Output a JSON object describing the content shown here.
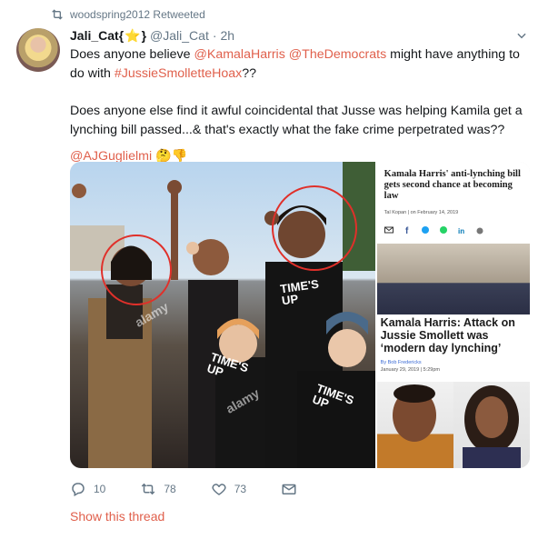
{
  "retweet": {
    "text": "woodspring2012 Retweeted",
    "icon": "retweet-icon"
  },
  "author": {
    "name": "Jali_Cat{",
    "name_suffix": "}",
    "star": "⭐",
    "handle": "@Jali_Cat",
    "separator": "·",
    "time": "2h"
  },
  "tweet": {
    "p1_a": "Does anyone believe ",
    "p1_link1": "@KamalaHarris",
    "p1_space": " ",
    "p1_link2": "@TheDemocrats",
    "p1_b": " might have anything to do with ",
    "p1_link3": "#JussieSmolletteHoax",
    "p1_c": "??",
    "p2": "Does anyone else find it awful coincidental that Jusse was helping Kamila get a lynching bill passed...& that's exactly what the fake crime perpetrated was??",
    "p3_link": "@AJGuglielmi",
    "p3_emoji": "🤔👎"
  },
  "media": {
    "watermark": "alamy",
    "article1": {
      "headline": "Kamala Harris' anti-lynching bill gets second chance at becoming law",
      "byline": "Tal Kopan  |  on February 14, 2019"
    },
    "article2": {
      "headline": "Kamala Harris: Attack on Jussie Smollett was ‘modern day lynching’",
      "by": "By Bob Fredericks",
      "date": "January 29, 2019 | 5:29pm"
    },
    "shirt_text": "TIME'S UP"
  },
  "actions": {
    "reply_count": "10",
    "retweet_count": "78",
    "like_count": "73"
  },
  "show_thread": "Show this thread",
  "colors": {
    "link": "#e0604c",
    "muted": "#657786",
    "circle": "#e0302a"
  }
}
